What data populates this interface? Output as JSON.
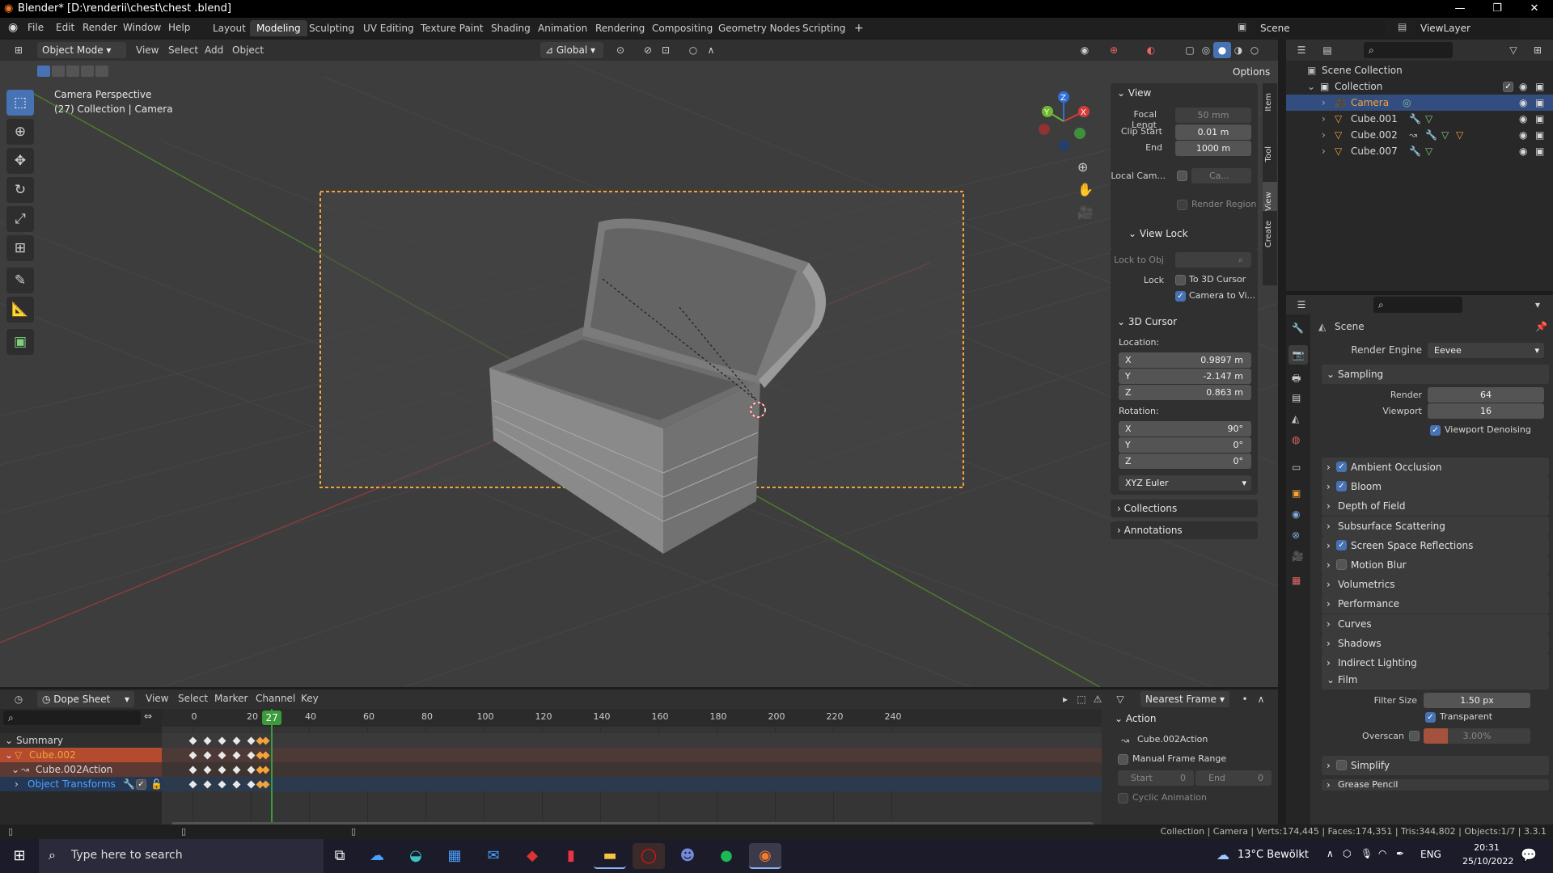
{
  "window": {
    "title": "Blender* [D:\\renderii\\chest\\chest .blend]",
    "min": "—",
    "max": "❐",
    "close": "✕"
  },
  "menus": [
    "File",
    "Edit",
    "Render",
    "Window",
    "Help"
  ],
  "workspaces": {
    "tabs": [
      "Layout",
      "Modeling",
      "Sculpting",
      "UV Editing",
      "Texture Paint",
      "Shading",
      "Animation",
      "Rendering",
      "Compositing",
      "Geometry Nodes",
      "Scripting"
    ],
    "active": "Modeling",
    "add": "+"
  },
  "scene": {
    "label": "Scene",
    "viewlayer": "ViewLayer"
  },
  "viewport_header": {
    "mode": "Object Mode",
    "menus": [
      "View",
      "Select",
      "Add",
      "Object"
    ],
    "orientation": "Global",
    "options": "Options"
  },
  "viewport": {
    "info_line1": "Camera Perspective",
    "info_line2": "(27) Collection | Camera",
    "axis_x": "X",
    "axis_y": "Y",
    "axis_z": "Z"
  },
  "npanel": {
    "view_title": "View",
    "focal_label": "Focal Lengt",
    "focal_value": "50 mm",
    "clip_start_label": "Clip Start",
    "clip_start_value": "0.01 m",
    "clip_end_label": "End",
    "clip_end_value": "1000 m",
    "local_cam_label": "Local Cam...",
    "local_cam_value": "Ca...",
    "render_region": "Render Region",
    "view_lock_title": "View Lock",
    "lock_to_obj": "Lock to Obj",
    "lock_label": "Lock",
    "to_3d_cursor": "To 3D Cursor",
    "camera_to_view": "Camera to Vi...",
    "cursor_title": "3D Cursor",
    "location_label": "Location:",
    "loc": [
      {
        "axis": "X",
        "value": "0.9897 m"
      },
      {
        "axis": "Y",
        "value": "-2.147 m"
      },
      {
        "axis": "Z",
        "value": "0.863 m"
      }
    ],
    "rotation_label": "Rotation:",
    "rot": [
      {
        "axis": "X",
        "value": "90°"
      },
      {
        "axis": "Y",
        "value": "0°"
      },
      {
        "axis": "Z",
        "value": "0°"
      }
    ],
    "rotation_mode": "XYZ Euler",
    "collections": "Collections",
    "annotations": "Annotations",
    "side_tabs": [
      "Item",
      "Tool",
      "View",
      "Create"
    ]
  },
  "outliner": {
    "scene_collection": "Scene Collection",
    "collection": "Collection",
    "items": [
      {
        "name": "Camera",
        "selected": true
      },
      {
        "name": "Cube.001",
        "selected": false
      },
      {
        "name": "Cube.002",
        "selected": false
      },
      {
        "name": "Cube.007",
        "selected": false
      }
    ]
  },
  "properties": {
    "scene_name": "Scene",
    "render_engine_label": "Render Engine",
    "render_engine": "Eevee",
    "sampling": "Sampling",
    "render_label": "Render",
    "render_value": "64",
    "viewport_label": "Viewport",
    "viewport_value": "16",
    "viewport_denoising": "Viewport Denoising",
    "sections": [
      {
        "name": "Ambient Occlusion",
        "check": true
      },
      {
        "name": "Bloom",
        "check": true
      },
      {
        "name": "Depth of Field",
        "check": null
      },
      {
        "name": "Subsurface Scattering",
        "check": null
      },
      {
        "name": "Screen Space Reflections",
        "check": true
      },
      {
        "name": "Motion Blur",
        "check": false
      },
      {
        "name": "Volumetrics",
        "check": null
      },
      {
        "name": "Performance",
        "check": null
      },
      {
        "name": "Curves",
        "check": null
      },
      {
        "name": "Shadows",
        "check": null
      },
      {
        "name": "Indirect Lighting",
        "check": null
      }
    ],
    "film": "Film",
    "filter_size_label": "Filter Size",
    "filter_size_value": "1.50 px",
    "transparent": "Transparent",
    "overscan_label": "Overscan",
    "overscan_value": "3.00%",
    "simplify": "Simplify",
    "grease_pencil": "Grease Pencil"
  },
  "dopesheet": {
    "editor": "Dope Sheet",
    "menus": [
      "View",
      "Select",
      "Marker",
      "Channel",
      "Key"
    ],
    "snap": "Nearest Frame",
    "current_frame": "27",
    "ticks": [
      "0",
      "20",
      "40",
      "60",
      "80",
      "100",
      "120",
      "140",
      "160",
      "180",
      "200",
      "220",
      "240"
    ],
    "channels": [
      {
        "name": "Summary",
        "type": "summary"
      },
      {
        "name": "Cube.002",
        "type": "object"
      },
      {
        "name": "Cube.002Action",
        "type": "action"
      },
      {
        "name": "Object Transforms",
        "type": "group"
      }
    ],
    "action_title": "Action",
    "action_name": "Cube.002Action",
    "manual_range": "Manual Frame Range",
    "start_label": "Start",
    "start_value": "0",
    "end_label": "End",
    "end_value": "0",
    "cyclic": "Cyclic Animation"
  },
  "statusbar": {
    "stats": "Collection | Camera | Verts:174,445 | Faces:174,351 | Tris:344,802 | Objects:1/7 | 3.3.1"
  },
  "taskbar": {
    "search_placeholder": "Type here to search",
    "weather": "13°C  Bewölkt",
    "lang": "ENG",
    "time": "20:31",
    "date": "25/10/2022"
  },
  "colors": {
    "accent": "#4772b3",
    "selection": "#f2a43a",
    "playhead": "#3b9b3b",
    "object_row": "#b44b2e"
  }
}
